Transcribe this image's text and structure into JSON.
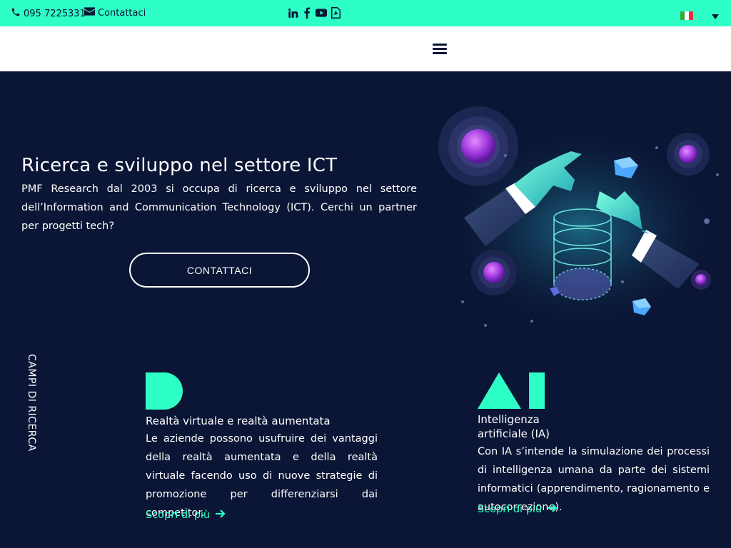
{
  "topbar": {
    "phone": "095 7225331",
    "contact": "Contattaci",
    "social_icons": [
      "linkedin-icon",
      "facebook-icon",
      "youtube-icon",
      "pdf-icon"
    ],
    "language_flag": "italy-flag",
    "colors": {
      "background": "#2effc6",
      "text": "#0b1535"
    }
  },
  "header": {
    "menu_icon": "hamburger-menu-icon"
  },
  "hero": {
    "title": "Ricerca e sviluppo nel settore ICT",
    "text": "PMF Research dal 2003 si occupa di ricerca e sviluppo nel settore dell’Information and Communication Technology (ICT). Cerchi un partner per progetti tech?",
    "button": "CONTATTACI"
  },
  "fields_label": "CAMPI DI RICERCA",
  "cards": [
    {
      "icon": "vr-letter-icon",
      "title": "Realtà virtuale e realtà aumentata",
      "text": "Le aziende possono usufruire dei vantaggi della realtà aumentata e della realtà virtuale facendo uso di nuove strategie di promozione per differenziarsi dai competitor.",
      "link": "Scopri di più"
    },
    {
      "icon": "ai-letters-icon",
      "title": "Intelligenza artificiale (IA)",
      "text": "Con IA s’intende la simulazione dei processi di intelligenza umana da parte dei sistemi informatici (apprendimento, ragionamento e autocorrezione).",
      "link": "Scopri di più"
    }
  ],
  "colors": {
    "accent": "#2effc6",
    "background": "#0b1535"
  }
}
